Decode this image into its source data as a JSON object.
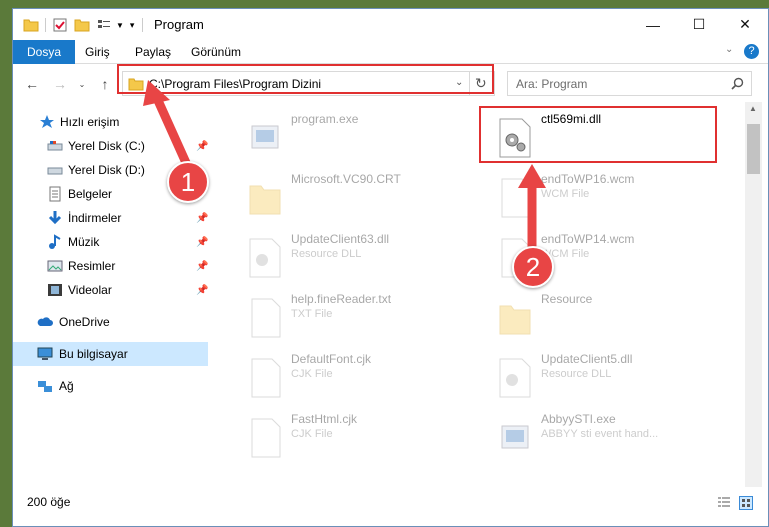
{
  "window": {
    "title": "Program",
    "buttons": [
      "—",
      "☐",
      "✕"
    ]
  },
  "ribbon": {
    "tabs": [
      "Dosya",
      "Giriş",
      "Paylaş",
      "Görünüm"
    ],
    "help": "?"
  },
  "address": {
    "path": "C:\\Program Files\\Program Dizini",
    "search_placeholder": "Ara: Program"
  },
  "sidebar": {
    "items": [
      {
        "label": "Hızlı erişim",
        "icon": "star-icon"
      },
      {
        "label": "Yerel Disk (C:)",
        "icon": "drive-icon",
        "pinned": true
      },
      {
        "label": "Yerel Disk (D:)",
        "icon": "drive-icon"
      },
      {
        "label": "Belgeler",
        "icon": "documents-icon"
      },
      {
        "label": "İndirmeler",
        "icon": "download-icon",
        "pinned": true
      },
      {
        "label": "Müzik",
        "icon": "music-icon",
        "pinned": true
      },
      {
        "label": "Resimler",
        "icon": "pictures-icon",
        "pinned": true
      },
      {
        "label": "Videolar",
        "icon": "video-icon",
        "pinned": true
      },
      {
        "label": "OneDrive",
        "icon": "cloud-icon"
      },
      {
        "label": "Bu bilgisayar",
        "icon": "computer-icon",
        "selected": true
      },
      {
        "label": "Ağ",
        "icon": "network-icon"
      }
    ]
  },
  "files": [
    {
      "name": "program.exe",
      "type": "",
      "icon": "exe-icon"
    },
    {
      "name": "ctl569mi.dll",
      "type": "",
      "icon": "dll-icon",
      "highlighted": true
    },
    {
      "name": "Microsoft.VC90.CRT",
      "type": "",
      "icon": "folder-icon"
    },
    {
      "name": "endToWP16.wcm",
      "type": "WCM File",
      "icon": "file-icon"
    },
    {
      "name": "UpdateClient63.dll",
      "type": "Resource DLL",
      "icon": "dll-icon"
    },
    {
      "name": "endToWP14.wcm",
      "type": "WCM File",
      "icon": "file-icon"
    },
    {
      "name": "help.fineReader.txt",
      "type": "TXT File",
      "icon": "file-icon"
    },
    {
      "name": "Resource",
      "type": "",
      "icon": "folder-icon"
    },
    {
      "name": "DefaultFont.cjk",
      "type": "CJK File",
      "icon": "file-icon"
    },
    {
      "name": "UpdateClient5.dll",
      "type": "Resource DLL",
      "icon": "dll-icon"
    },
    {
      "name": "FastHtml.cjk",
      "type": "CJK File",
      "icon": "file-icon"
    },
    {
      "name": "AbbyySTI.exe",
      "type": "ABBYY sti event hand...",
      "icon": "exe-icon"
    }
  ],
  "status": {
    "count": "200 öğe"
  },
  "annotations": {
    "step1": "1",
    "step2": "2",
    "color": "#e84545"
  }
}
